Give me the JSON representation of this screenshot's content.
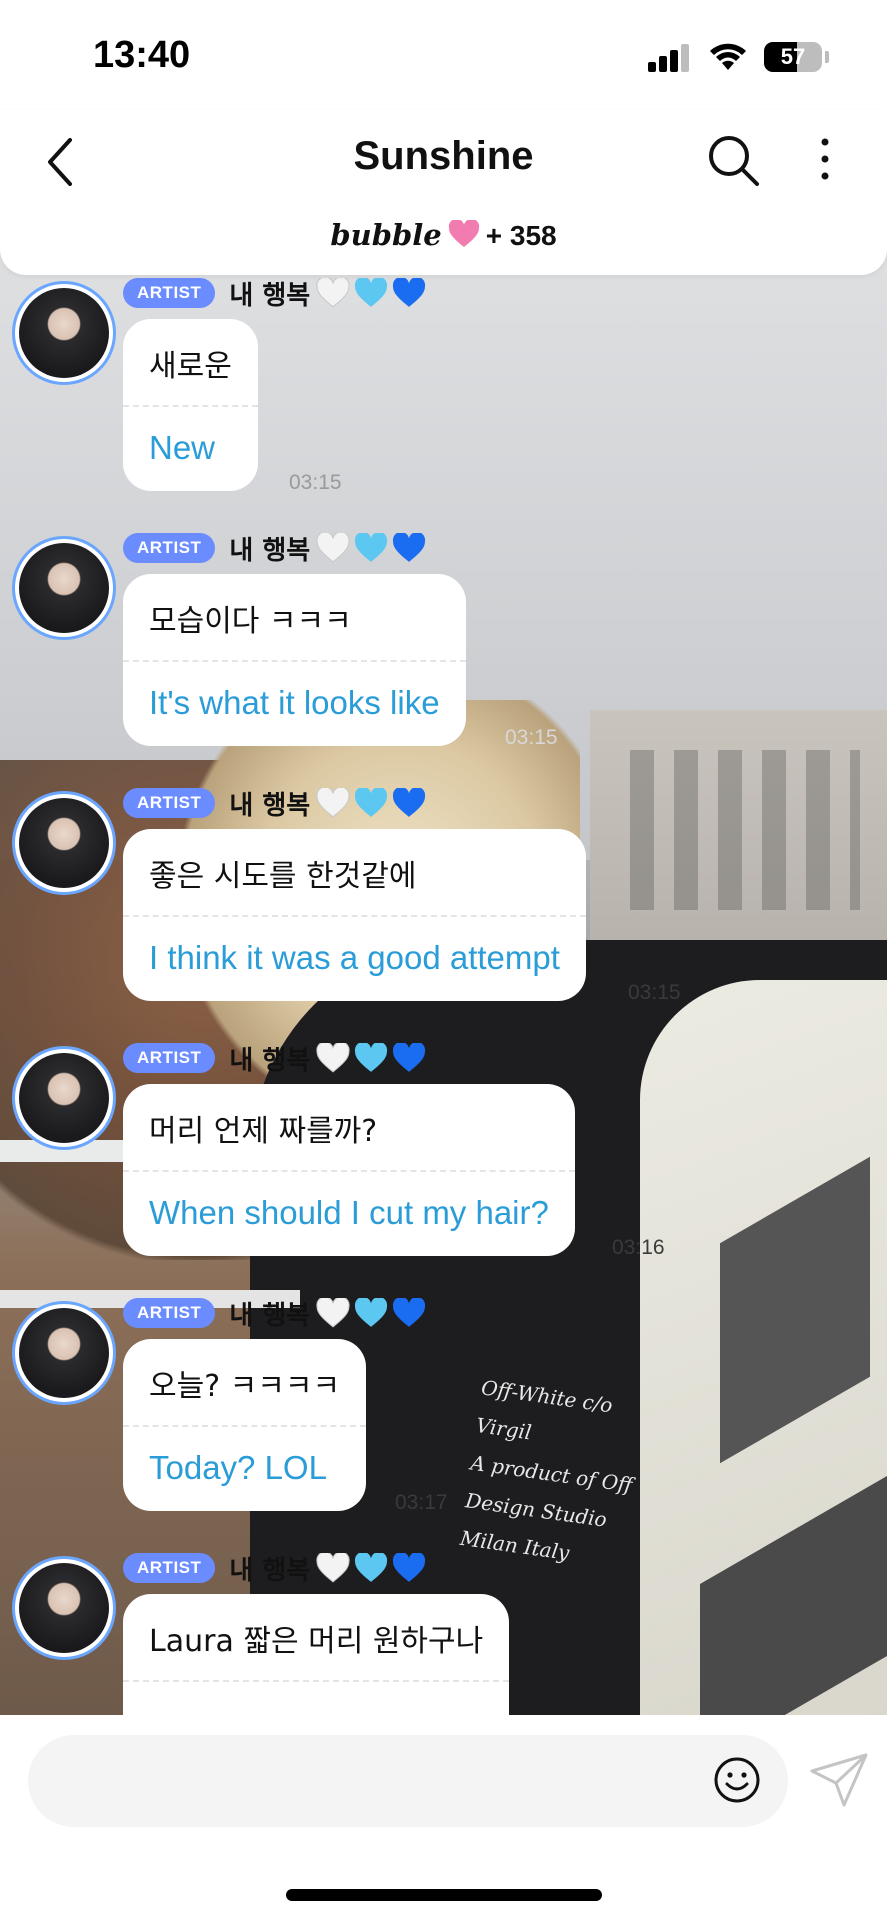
{
  "status_bar": {
    "time": "13:40",
    "battery_level": "57",
    "icons": [
      "cellular-signal-icon",
      "wifi-icon",
      "battery-icon"
    ]
  },
  "header": {
    "title": "Sunshine",
    "brand": "bubble",
    "subscriber_count": "+ 358",
    "icons": [
      "back-chevron-icon",
      "search-icon",
      "more-vertical-icon",
      "pink-heart-icon"
    ]
  },
  "messages": [
    {
      "badge": "ARTIST",
      "sender": "내 행복",
      "korean": "새로운",
      "english": "New",
      "time": "03:15"
    },
    {
      "badge": "ARTIST",
      "sender": "내 행복",
      "korean": "모습이다 ㅋㅋㅋ",
      "english": "It's what it looks like",
      "time": "03:15"
    },
    {
      "badge": "ARTIST",
      "sender": "내 행복",
      "korean": "좋은 시도를 한것같에",
      "english": "I think it was a good attempt",
      "time": "03:15"
    },
    {
      "badge": "ARTIST",
      "sender": "내 행복",
      "korean": "머리 언제 짜를까?",
      "english": "When should I cut my hair?",
      "time": "03:16"
    },
    {
      "badge": "ARTIST",
      "sender": "내 행복",
      "korean": "오늘? ㅋㅋㅋㅋ",
      "english": "Today? LOL",
      "time": "03:17"
    },
    {
      "badge": "ARTIST",
      "sender": "내 행복",
      "korean": "Laura 짧은 머리 원하구나",
      "english": "",
      "time": ""
    }
  ],
  "sender_hearts": [
    "white-heart-icon",
    "light-blue-heart-icon",
    "blue-heart-icon"
  ],
  "background_text": [
    "Off-White c/o Virgil",
    "A product of Off",
    "Design Studio Milan Italy"
  ],
  "composer": {
    "icons": [
      "emoji-icon",
      "send-paper-plane-icon"
    ]
  },
  "colors": {
    "artist_badge": "#6b8cff",
    "translation_text": "#2a9cd8",
    "avatar_ring": "#6aa6ff",
    "heart_pink": "#f27bb0",
    "heart_light_blue": "#5cc8f2",
    "heart_blue": "#1a6cf0"
  }
}
